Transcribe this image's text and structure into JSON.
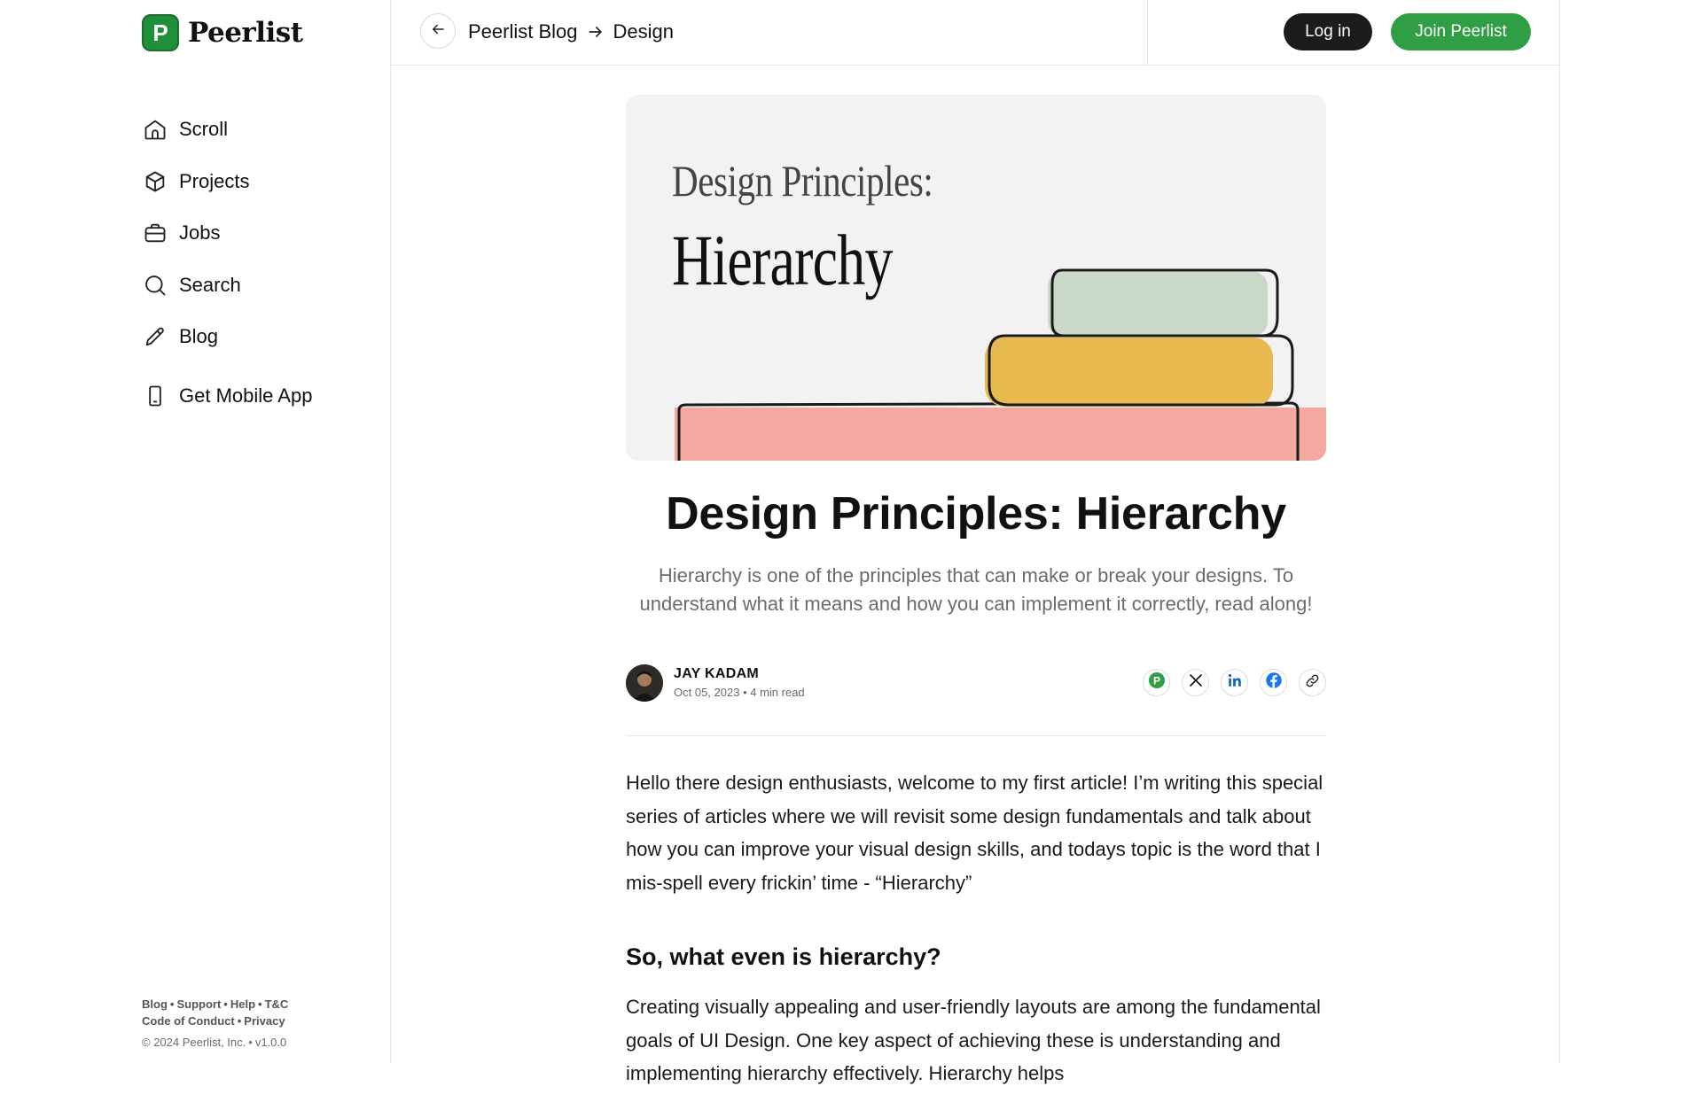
{
  "brand": {
    "name": "Peerlist",
    "mark": "P",
    "accent": "#2f9e44"
  },
  "sidebar": {
    "items": [
      {
        "label": "Scroll",
        "icon": "home-icon"
      },
      {
        "label": "Projects",
        "icon": "cube-icon"
      },
      {
        "label": "Jobs",
        "icon": "briefcase-icon"
      },
      {
        "label": "Search",
        "icon": "search-icon"
      },
      {
        "label": "Blog",
        "icon": "pencil-icon"
      }
    ],
    "mobile_app": {
      "label": "Get Mobile App",
      "icon": "phone-icon"
    },
    "footer": {
      "links": [
        "Blog",
        "Support",
        "Help",
        "T&C",
        "Code of Conduct",
        "Privacy"
      ],
      "copyright": "© 2024 Peerlist, Inc.",
      "version": "v1.0.0"
    }
  },
  "header": {
    "breadcrumb": [
      "Peerlist Blog",
      "Design"
    ],
    "login_label": "Log in",
    "join_label": "Join Peerlist"
  },
  "article": {
    "hero": {
      "line1": "Design Principles:",
      "line2": "Hierarchy"
    },
    "title": "Design Principles: Hierarchy",
    "subtitle": "Hierarchy is one of the principles that can make or break your designs. To understand what it means and how you can implement it correctly, read along!",
    "author": "JAY KADAM",
    "date": "Oct 05, 2023",
    "read_time": "4 min read",
    "share": [
      "peerlist-icon",
      "x-icon",
      "linkedin-icon",
      "facebook-icon",
      "link-icon"
    ],
    "intro": "Hello there design enthusiasts, welcome to my first article! I’m writing this special series of articles where we will revisit some design fundamentals and talk about how you can improve your visual design skills, and todays topic is the word that I mis-spell every frickin’ time - “Hierarchy”",
    "section_heading": "So, what even is hierarchy?",
    "section_text": "Creating visually appealing and user-friendly layouts are among the fundamental goals of UI Design. One key aspect of achieving these is understanding and implementing hierarchy effectively. Hierarchy helps"
  }
}
